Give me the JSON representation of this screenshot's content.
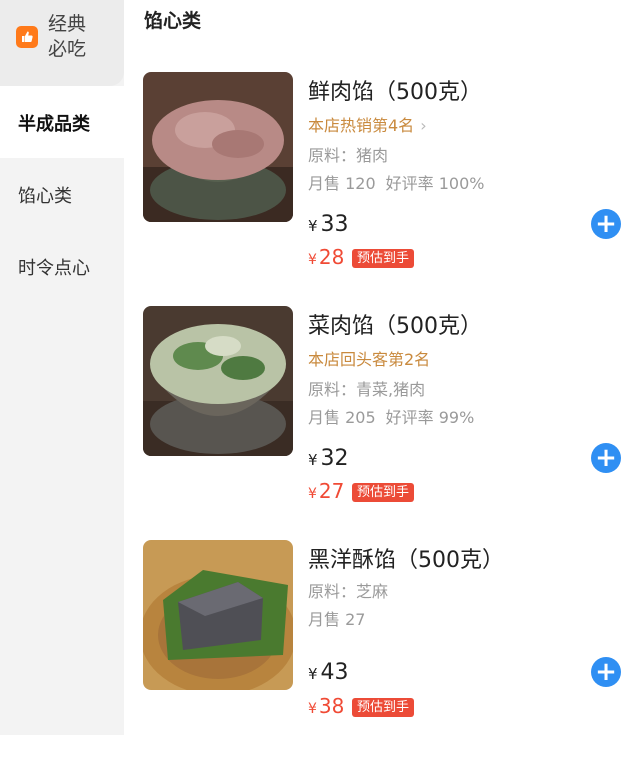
{
  "sidebar": {
    "featured": {
      "icon": "thumbs-up-icon",
      "line1": "经典",
      "line2": "必吃"
    },
    "items": [
      {
        "label": "半成品类",
        "selected": true
      },
      {
        "label": "馅心类",
        "selected": false
      },
      {
        "label": "时令点心",
        "selected": false
      }
    ]
  },
  "main": {
    "section_title": "馅心类",
    "products": [
      {
        "name": "鲜肉馅（500克）",
        "rank": "本店热销第4名",
        "rank_chevron": "›",
        "ingredients": "原料：猪肉",
        "monthly_sales": "月售 120",
        "rating": "好评率 100%",
        "currency": "¥",
        "price": "33",
        "discount_price": "28",
        "discount_tag": "预估到手"
      },
      {
        "name": "菜肉馅（500克）",
        "rank": "本店回头客第2名",
        "ingredients": "原料：青菜,猪肉",
        "monthly_sales": "月售 205",
        "rating": "好评率 99%",
        "currency": "¥",
        "price": "32",
        "discount_price": "27",
        "discount_tag": "预估到手"
      },
      {
        "name": "黑洋酥馅（500克）",
        "ingredients": "原料：芝麻",
        "monthly_sales": "月售 27",
        "currency": "¥",
        "price": "43",
        "discount_price": "38",
        "discount_tag": "预估到手"
      }
    ]
  },
  "colors": {
    "accent_blue": "#2f8ff3",
    "discount_red": "#f04a35",
    "rank_gold": "#c98a3e",
    "badge_orange": "#ff7a1a"
  }
}
